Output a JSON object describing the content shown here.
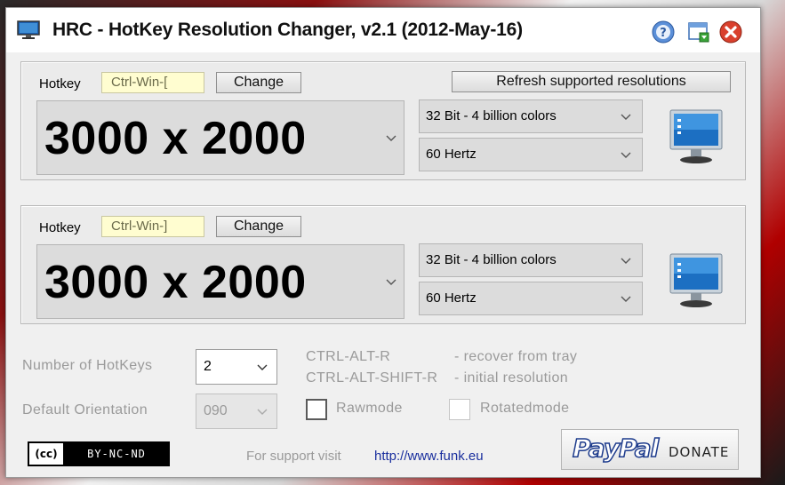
{
  "window": {
    "title": "HRC - HotKey Resolution Changer, v2.1 (2012-May-16)"
  },
  "hotkeys": [
    {
      "label": "Hotkey",
      "combo": "Ctrl-Win-[",
      "change_label": "Change",
      "resolution": "3000 x 2000",
      "color_depth": "32 Bit - 4 billion colors",
      "refresh_rate": "60 Hertz"
    },
    {
      "label": "Hotkey",
      "combo": "Ctrl-Win-]",
      "change_label": "Change",
      "resolution": "3000 x 2000",
      "color_depth": "32 Bit - 4 billion colors",
      "refresh_rate": "60 Hertz"
    }
  ],
  "refresh_label": "Refresh supported resolutions",
  "settings": {
    "num_hotkeys_label": "Number of HotKeys",
    "num_hotkeys_value": "2",
    "orientation_label": "Default Orientation",
    "orientation_value": "090",
    "rawmode_label": "Rawmode",
    "rawmode_checked": false,
    "rotatedmode_label": "Rotatedmode",
    "rotatedmode_checked": false
  },
  "shortcuts": [
    {
      "keys": "CTRL-ALT-R",
      "desc": "- recover from tray"
    },
    {
      "keys": "CTRL-ALT-SHIFT-R",
      "desc": "- initial resolution"
    }
  ],
  "footer": {
    "license_cc": "(cc)",
    "license_text": "BY-NC-ND",
    "support_text": "For support visit",
    "support_link": "http://www.funk.eu",
    "paypal_logo": "PayPal",
    "donate_label": "DONATE"
  },
  "colors": {
    "hotkey_field": "#fffdd0",
    "link": "#1a2f9e",
    "panel": "#ebebeb"
  },
  "icons": [
    "monitor-icon",
    "help-icon",
    "minimize-to-tray-icon",
    "close-icon",
    "chevron-down-icon"
  ]
}
